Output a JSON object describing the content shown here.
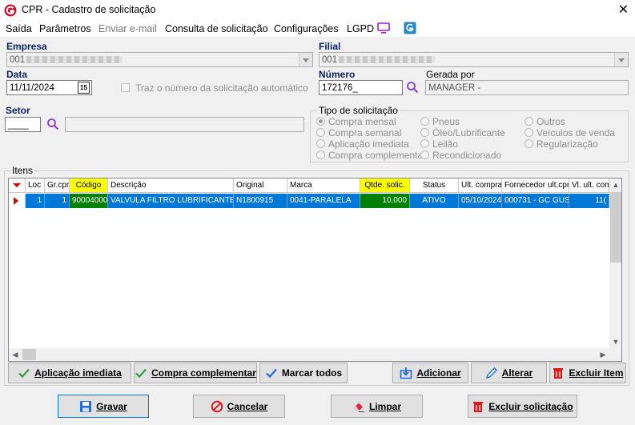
{
  "window": {
    "title": "CPR - Cadastro de solicitação",
    "close": "✕"
  },
  "menu": {
    "items": [
      "Saída",
      "Parâmetros",
      "Enviar e-mail",
      "Consulta de solicitação",
      "Configurações",
      "LGPD"
    ]
  },
  "form": {
    "empresa_label": "Empresa",
    "empresa_value": "001",
    "filial_label": "Filial",
    "filial_value": "001",
    "data_label": "Data",
    "data_value": "11/11/2024",
    "calendar_day": "15",
    "numero_label": "Número",
    "numero_value": "172176_",
    "gerada_label": "Gerada por",
    "gerada_value": "MANAGER -",
    "auto_checkbox_label": "Traz o número da solicitação automático",
    "setor_label": "Setor",
    "setor_value": "____"
  },
  "tipo": {
    "title": "Tipo de solicitação",
    "options": [
      "Compra mensal",
      "Compra semanal",
      "Aplicação imediata",
      "Compra complementar",
      "Pneus",
      "Óleo/Lubrificante",
      "Leilão",
      "Recondicionado",
      "Outros",
      "Veículos de venda",
      "Regularização"
    ],
    "selected": "Compra mensal"
  },
  "itens": {
    "title": "Itens",
    "columns": [
      "Loc",
      "Gr.cpr",
      "Código",
      "Descrição",
      "Original",
      "Marca",
      "Qtde. solic.",
      "Status",
      "Ult. compra",
      "Fornecedor ult.cpr",
      "Vl. ult. com"
    ],
    "rows": [
      [
        "1",
        "1",
        "90004000",
        "VALVULA FILTRO LUBRIFICANTE...",
        "N1800915",
        "0041-PARALELA",
        "10,000",
        "ATIVO",
        "05/10/2024",
        "000731 - GC GUS...",
        "11("
      ]
    ]
  },
  "grid_buttons": {
    "aplicacao": "Aplicação imediata",
    "complementar": "Compra complementar",
    "marcar": "Marcar todos",
    "adicionar": "Adicionar",
    "alterar": "Alterar",
    "excluir_item": "Excluir Item"
  },
  "footer_buttons": {
    "gravar": "Gravar",
    "cancelar": "Cancelar",
    "limpar": "Limpar",
    "excluir_solicitacao": "Excluir solicitação"
  },
  "colors": {
    "label_blue": "#0a246a",
    "row_selected": "#0078d7",
    "header_yellow": "#ffff00",
    "qty_green": "#008000",
    "logo_red": "#c8102e",
    "check_green": "#2ea043"
  }
}
